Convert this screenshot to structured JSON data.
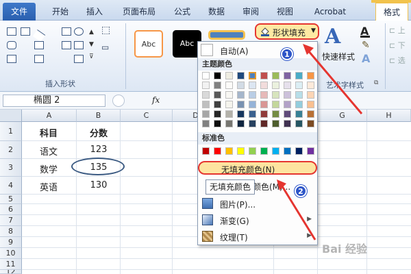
{
  "tabs": [
    "文件",
    "开始",
    "插入",
    "页面布局",
    "公式",
    "数据",
    "审阅",
    "视图",
    "Acrobat",
    "格式"
  ],
  "ribbon": {
    "insert_shapes_label": "插入形状",
    "style_samples": [
      "Abc",
      "Abc"
    ],
    "shape_fill": "形状填充",
    "quick_styles": "快速样式",
    "art_text_label": "艺术字样式"
  },
  "name_box": "椭圆 2",
  "fx_symbol": "fx",
  "columns": [
    "A",
    "B",
    "C",
    "D",
    "E",
    "F",
    "G",
    "H"
  ],
  "rows": [
    "1",
    "2",
    "3",
    "4",
    "5",
    "6",
    "7",
    "8",
    "9",
    "10",
    "11",
    "12"
  ],
  "cells": {
    "a1": "科目",
    "b1": "分数",
    "a2": "语文",
    "b2": "123",
    "a3": "数学",
    "b3": "135",
    "a4": "英语",
    "b4": "130"
  },
  "dropdown": {
    "auto": "自动(A)",
    "theme_header": "主题颜色",
    "standard_header": "标准色",
    "no_fill": "无填充颜色(N)",
    "more_colors_tail": "颜色(M)...",
    "picture": "图片(P)...",
    "gradient": "渐变(G)",
    "texture": "纹理(T)",
    "tooltip": "无填充颜色"
  },
  "theme_colors": [
    "#ffffff",
    "#000000",
    "#eeece1",
    "#1f497d",
    "#4f81bd",
    "#c0504d",
    "#9bbb59",
    "#8064a2",
    "#4bacc6",
    "#f79646"
  ],
  "standard_colors": [
    "#c00000",
    "#ff0000",
    "#ffc000",
    "#ffff00",
    "#92d050",
    "#00b050",
    "#00b0f0",
    "#0070c0",
    "#002060",
    "#7030a0"
  ],
  "badges": [
    "1",
    "2"
  ],
  "watermark": "Bai 经验"
}
